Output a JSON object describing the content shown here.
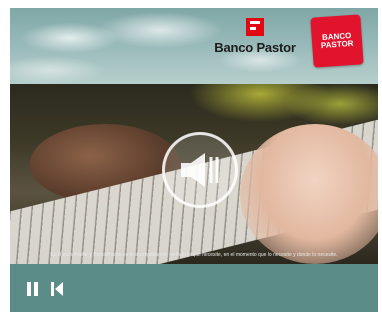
{
  "header": {
    "brand_name": "Banco Pastor",
    "badge_text": "BANCO PASTOR"
  },
  "video": {
    "caption": "En Banco Pastor y BancoPastor.es le acompañamos en todo lo que necesite, en el momento que lo necesite y donde lo necesite.",
    "muted": true
  },
  "controls": {
    "pause_icon": "pause-icon",
    "restart_icon": "skip-back-icon"
  },
  "colors": {
    "brand_red": "#e30613",
    "badge_red": "#e2142d",
    "frame_teal": "#5b8c88"
  }
}
